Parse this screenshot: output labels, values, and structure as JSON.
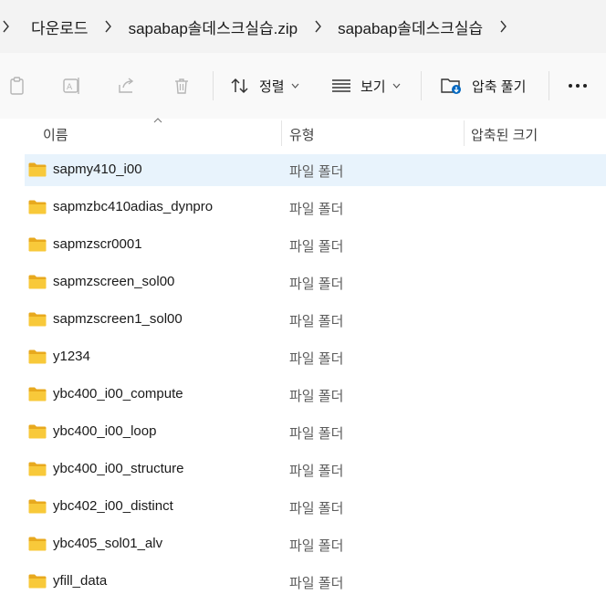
{
  "breadcrumb": {
    "items": [
      "다운로드",
      "sapabap솔데스크실습.zip",
      "sapabap솔데스크실습"
    ]
  },
  "toolbar": {
    "icons": [
      "clipboard-icon",
      "rename-icon",
      "share-icon",
      "trash-icon"
    ],
    "sort_label": "정렬",
    "view_label": "보기",
    "extract_label": "압축 풀기",
    "more_label": "•••"
  },
  "columns": {
    "name": "이름",
    "type": "유형",
    "compressed_size": "압축된 크기"
  },
  "colors": {
    "folder": "#f8c93a",
    "folder_dark": "#e8a91e",
    "selection": "#e8f3fc",
    "accent": "#0067c0"
  },
  "files": [
    {
      "name": "sapmy410_i00",
      "type": "파일 폴더",
      "selected": true
    },
    {
      "name": "sapmzbc410adias_dynpro",
      "type": "파일 폴더"
    },
    {
      "name": "sapmzscr0001",
      "type": "파일 폴더"
    },
    {
      "name": "sapmzscreen_sol00",
      "type": "파일 폴더"
    },
    {
      "name": "sapmzscreen1_sol00",
      "type": "파일 폴더"
    },
    {
      "name": "y1234",
      "type": "파일 폴더"
    },
    {
      "name": "ybc400_i00_compute",
      "type": "파일 폴더"
    },
    {
      "name": "ybc400_i00_loop",
      "type": "파일 폴더"
    },
    {
      "name": "ybc400_i00_structure",
      "type": "파일 폴더"
    },
    {
      "name": "ybc402_i00_distinct",
      "type": "파일 폴더"
    },
    {
      "name": "ybc405_sol01_alv",
      "type": "파일 폴더"
    },
    {
      "name": "yfill_data",
      "type": "파일 폴더"
    }
  ]
}
